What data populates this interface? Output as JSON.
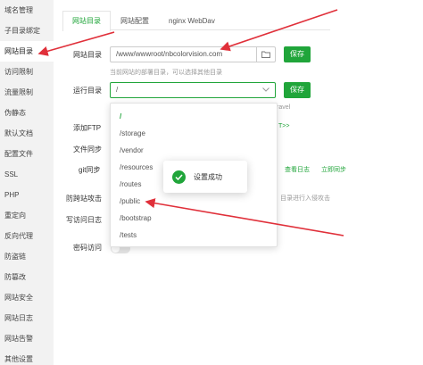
{
  "sidebar": {
    "items": [
      {
        "label": "域名管理",
        "active": false
      },
      {
        "label": "子目录绑定",
        "active": false
      },
      {
        "label": "网站目录",
        "active": true
      },
      {
        "label": "访问限制",
        "active": false
      },
      {
        "label": "流量限制",
        "active": false
      },
      {
        "label": "伪静态",
        "active": false
      },
      {
        "label": "默认文档",
        "active": false
      },
      {
        "label": "配置文件",
        "active": false
      },
      {
        "label": "SSL",
        "active": false
      },
      {
        "label": "PHP",
        "active": false
      },
      {
        "label": "重定向",
        "active": false
      },
      {
        "label": "反向代理",
        "active": false
      },
      {
        "label": "防盗链",
        "active": false
      },
      {
        "label": "防篡改",
        "active": false
      },
      {
        "label": "网站安全",
        "active": false
      },
      {
        "label": "网站日志",
        "active": false
      },
      {
        "label": "网站告警",
        "active": false
      },
      {
        "label": "其他设置",
        "active": false
      }
    ]
  },
  "tabs": [
    {
      "label": "网站目录",
      "active": true
    },
    {
      "label": "网站配置",
      "active": false
    },
    {
      "label": "nginx WebDav",
      "active": false
    }
  ],
  "site_dir": {
    "label": "网站目录",
    "value": "/www/wwwroot/nbcolorvision.com",
    "save_label": "保存",
    "hint": "当前网站的部署目录，可以选择其他目录"
  },
  "run_dir": {
    "label": "运行目录",
    "value": "/",
    "save_label": "保存",
    "hint_tail": "ravel"
  },
  "partial_labels": {
    "add_ftp": "添加FTP",
    "file_sync": "文件同步",
    "git_sync": "git同步",
    "anti_cross": "防跨站攻击",
    "write_log": "写访问日志",
    "password_access": "密码访问",
    "ftp_link": "T>>",
    "view_log": "查看日志",
    "sync_now": "立即同步",
    "anti_cross_desc": "目录进行入侵攻击"
  },
  "dropdown": {
    "options": [
      {
        "label": "/",
        "selected": true
      },
      {
        "label": "/storage",
        "selected": false
      },
      {
        "label": "/vendor",
        "selected": false
      },
      {
        "label": "/resources",
        "selected": false
      },
      {
        "label": "/routes",
        "selected": false
      },
      {
        "label": "/public",
        "selected": false
      },
      {
        "label": "/bootstrap",
        "selected": false
      },
      {
        "label": "/tests",
        "selected": false
      }
    ]
  },
  "toast": {
    "message": "设置成功",
    "icon": "check-circle-icon"
  },
  "colors": {
    "accent": "#20a53a",
    "annotation_arrow": "#e0303a"
  }
}
